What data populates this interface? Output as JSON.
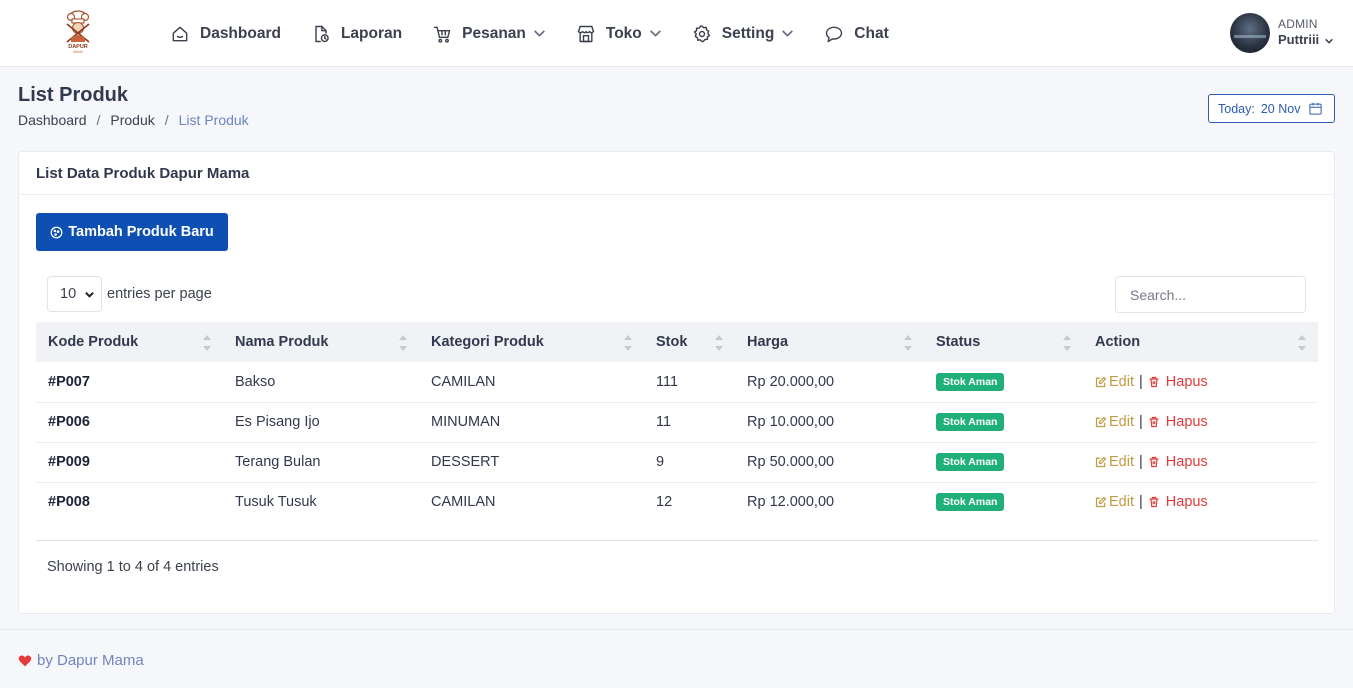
{
  "brand": {
    "logo_text": "DAPUR",
    "logo_subtext": "MAMA"
  },
  "nav": [
    {
      "label": "Dashboard",
      "icon": "home-icon",
      "dropdown": false
    },
    {
      "label": "Laporan",
      "icon": "report-icon",
      "dropdown": false
    },
    {
      "label": "Pesanan",
      "icon": "cart-icon",
      "dropdown": true
    },
    {
      "label": "Toko",
      "icon": "store-icon",
      "dropdown": true
    },
    {
      "label": "Setting",
      "icon": "gear-icon",
      "dropdown": true
    },
    {
      "label": "Chat",
      "icon": "chat-icon",
      "dropdown": false
    }
  ],
  "user": {
    "role": "ADMIN",
    "name": "Puttriii"
  },
  "page": {
    "title": "List Produk",
    "breadcrumb": [
      "Dashboard",
      "Produk",
      "List Produk"
    ],
    "date_label": "Today:",
    "date_value": "20 Nov"
  },
  "card": {
    "title": "List Data Produk Dapur Mama",
    "add_button": "Tambah Produk Baru"
  },
  "table_controls": {
    "per_page_value": "10",
    "per_page_label": "entries per page",
    "search_placeholder": "Search..."
  },
  "table": {
    "columns": [
      "Kode Produk",
      "Nama Produk",
      "Kategori Produk",
      "Stok",
      "Harga",
      "Status",
      "Action"
    ],
    "rows": [
      {
        "code": "#P007",
        "name": "Bakso",
        "category": "CAMILAN",
        "stock": "111",
        "price": "Rp 20.000,00",
        "status": "Stok Aman"
      },
      {
        "code": "#P006",
        "name": "Es Pisang Ijo",
        "category": "MINUMAN",
        "stock": "11",
        "price": "Rp 10.000,00",
        "status": "Stok Aman"
      },
      {
        "code": "#P009",
        "name": "Terang Bulan",
        "category": "DESSERT",
        "stock": "9",
        "price": "Rp 50.000,00",
        "status": "Stok Aman"
      },
      {
        "code": "#P008",
        "name": "Tusuk Tusuk",
        "category": "CAMILAN",
        "stock": "12",
        "price": "Rp 12.000,00",
        "status": "Stok Aman"
      }
    ],
    "edit_label": "Edit",
    "separator": "|",
    "delete_label": "Hapus"
  },
  "table_info": "Showing 1 to 4 of 4 entries",
  "footer": {
    "text": "by Dapur Mama"
  },
  "colors": {
    "primary": "#0d4fb3",
    "success": "#1fb07a",
    "danger": "#e23b3b",
    "warning": "#c09a3e"
  }
}
